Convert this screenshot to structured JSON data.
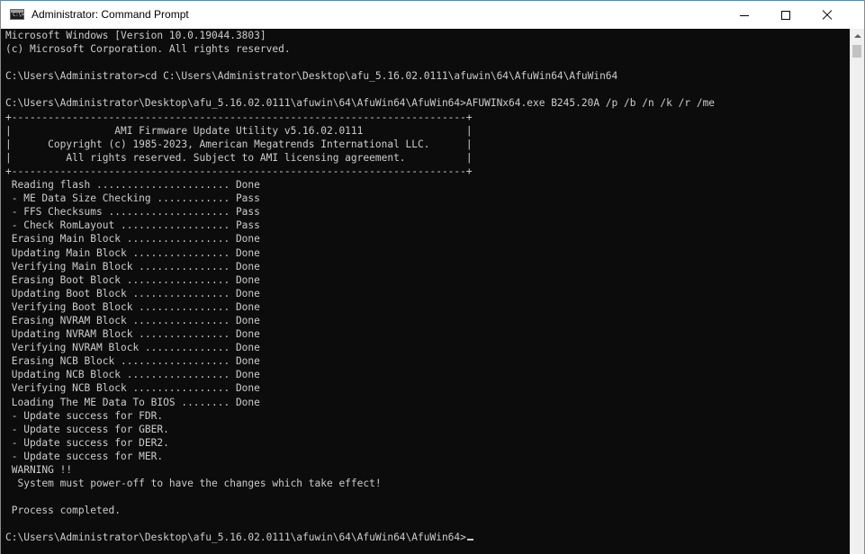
{
  "window": {
    "title": "Administrator: Command Prompt",
    "icon_glyph": "C:\\>",
    "controls": {
      "minimize_icon": "minimize-icon",
      "maximize_icon": "maximize-icon",
      "close_icon": "close-icon"
    }
  },
  "console": {
    "lines": [
      "Microsoft Windows [Version 10.0.19044.3803]",
      "(c) Microsoft Corporation. All rights reserved.",
      "",
      "C:\\Users\\Administrator>cd C:\\Users\\Administrator\\Desktop\\afu_5.16.02.0111\\afuwin\\64\\AfuWin64\\AfuWin64",
      "",
      "C:\\Users\\Administrator\\Desktop\\afu_5.16.02.0111\\afuwin\\64\\AfuWin64\\AfuWin64>AFUWINx64.exe B245.20A /p /b /n /k /r /me",
      "+---------------------------------------------------------------------------+",
      "|                 AMI Firmware Update Utility v5.16.02.0111                 |",
      "|      Copyright (c) 1985-2023, American Megatrends International LLC.      |",
      "|         All rights reserved. Subject to AMI licensing agreement.          |",
      "+---------------------------------------------------------------------------+",
      " Reading flash ...................... Done",
      " - ME Data Size Checking ............ Pass",
      " - FFS Checksums .................... Pass",
      " - Check RomLayout .................. Pass",
      " Erasing Main Block ................. Done",
      " Updating Main Block ................ Done",
      " Verifying Main Block ............... Done",
      " Erasing Boot Block ................. Done",
      " Updating Boot Block ................ Done",
      " Verifying Boot Block ............... Done",
      " Erasing NVRAM Block ................ Done",
      " Updating NVRAM Block ............... Done",
      " Verifying NVRAM Block .............. Done",
      " Erasing NCB Block .................. Done",
      " Updating NCB Block ................. Done",
      " Verifying NCB Block ................ Done",
      " Loading The ME Data To BIOS ........ Done",
      " - Update success for FDR.",
      " - Update success for GBER.",
      " - Update success for DER2.",
      " - Update success for MER.",
      " WARNING !!",
      "  System must power-off to have the changes which take effect!",
      "",
      " Process completed.",
      ""
    ],
    "prompt": "C:\\Users\\Administrator\\Desktop\\afu_5.16.02.0111\\afuwin\\64\\AfuWin64\\AfuWin64>"
  },
  "scrollbar": {
    "up_icon": "scroll-up-arrow-icon"
  },
  "colors": {
    "console_bg": "#0c0c0c",
    "console_fg": "#cccccc",
    "titlebar_bg": "#ffffff",
    "accent_border": "#3c8fd1"
  }
}
